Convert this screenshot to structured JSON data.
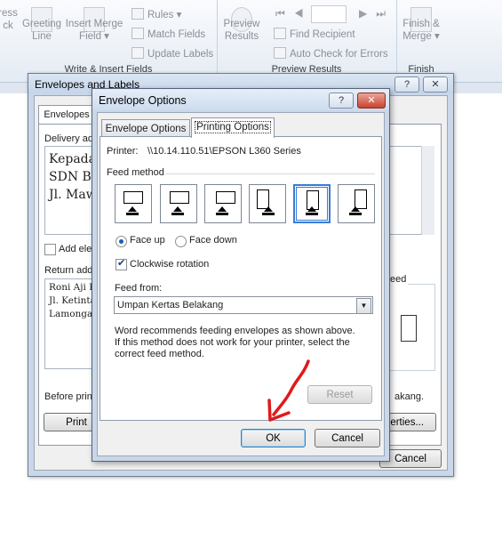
{
  "ribbon": {
    "write_insert": {
      "partial_btn": "ress\nck",
      "greeting": "Greeting\nLine",
      "merge_field": "Insert Merge\nField ▾",
      "rules": "Rules ▾",
      "match_fields": "Match Fields",
      "update_labels": "Update Labels",
      "group_label": "Write & Insert Fields"
    },
    "preview": {
      "preview_results": "Preview\nResults",
      "find_recipient": "Find Recipient",
      "auto_check": "Auto Check for Errors",
      "group_label": "Preview Results"
    },
    "finish": {
      "finish_merge": "Finish &\nMerge ▾",
      "group_label": "Finish"
    }
  },
  "bg_dialog": {
    "title": "Envelopes and Labels",
    "help": "?",
    "close": "✕",
    "tab_envelopes": "Envelopes",
    "delivery_label": "Delivery add",
    "delivery_lines": [
      "Kepada",
      "SDN Bu",
      "Jl. Mawa"
    ],
    "add_electronic": "Add ele",
    "return_label": "Return add",
    "return_lines": [
      "Roni Aji P",
      "Jl. Ketinta",
      "Lamongan"
    ],
    "feed_label": "eed",
    "before_print": "Before print",
    "before_print_end": "akang.",
    "print_btn": "Print",
    "properties_btn": "perties...",
    "cancel_btn": "Cancel"
  },
  "dialog": {
    "title": "Envelope Options",
    "help": "?",
    "close": "✕",
    "tabs": [
      "Envelope Options",
      "Printing Options"
    ],
    "selected_tab": "Printing Options",
    "printer_label": "Printer:",
    "printer_name": "\\\\10.14.110.51\\EPSON L360 Series",
    "feed_method_label": "Feed method",
    "feed_methods_selected_index": 4,
    "face_up": "Face up",
    "face_down": "Face down",
    "face_selected": "Face up",
    "clockwise": "Clockwise rotation",
    "clockwise_checked": true,
    "feed_from_label": "Feed from:",
    "feed_from_value": "Umpan Kertas Belakang",
    "recommend_text": "Word recommends feeding envelopes as shown above.\nIf this method does not work for your printer, select the\ncorrect feed method.",
    "reset_btn": "Reset",
    "ok_btn": "OK",
    "cancel_btn": "Cancel"
  },
  "colors": {
    "accent": "#3a7bd5",
    "annotation_arrow": "#e0191b"
  }
}
